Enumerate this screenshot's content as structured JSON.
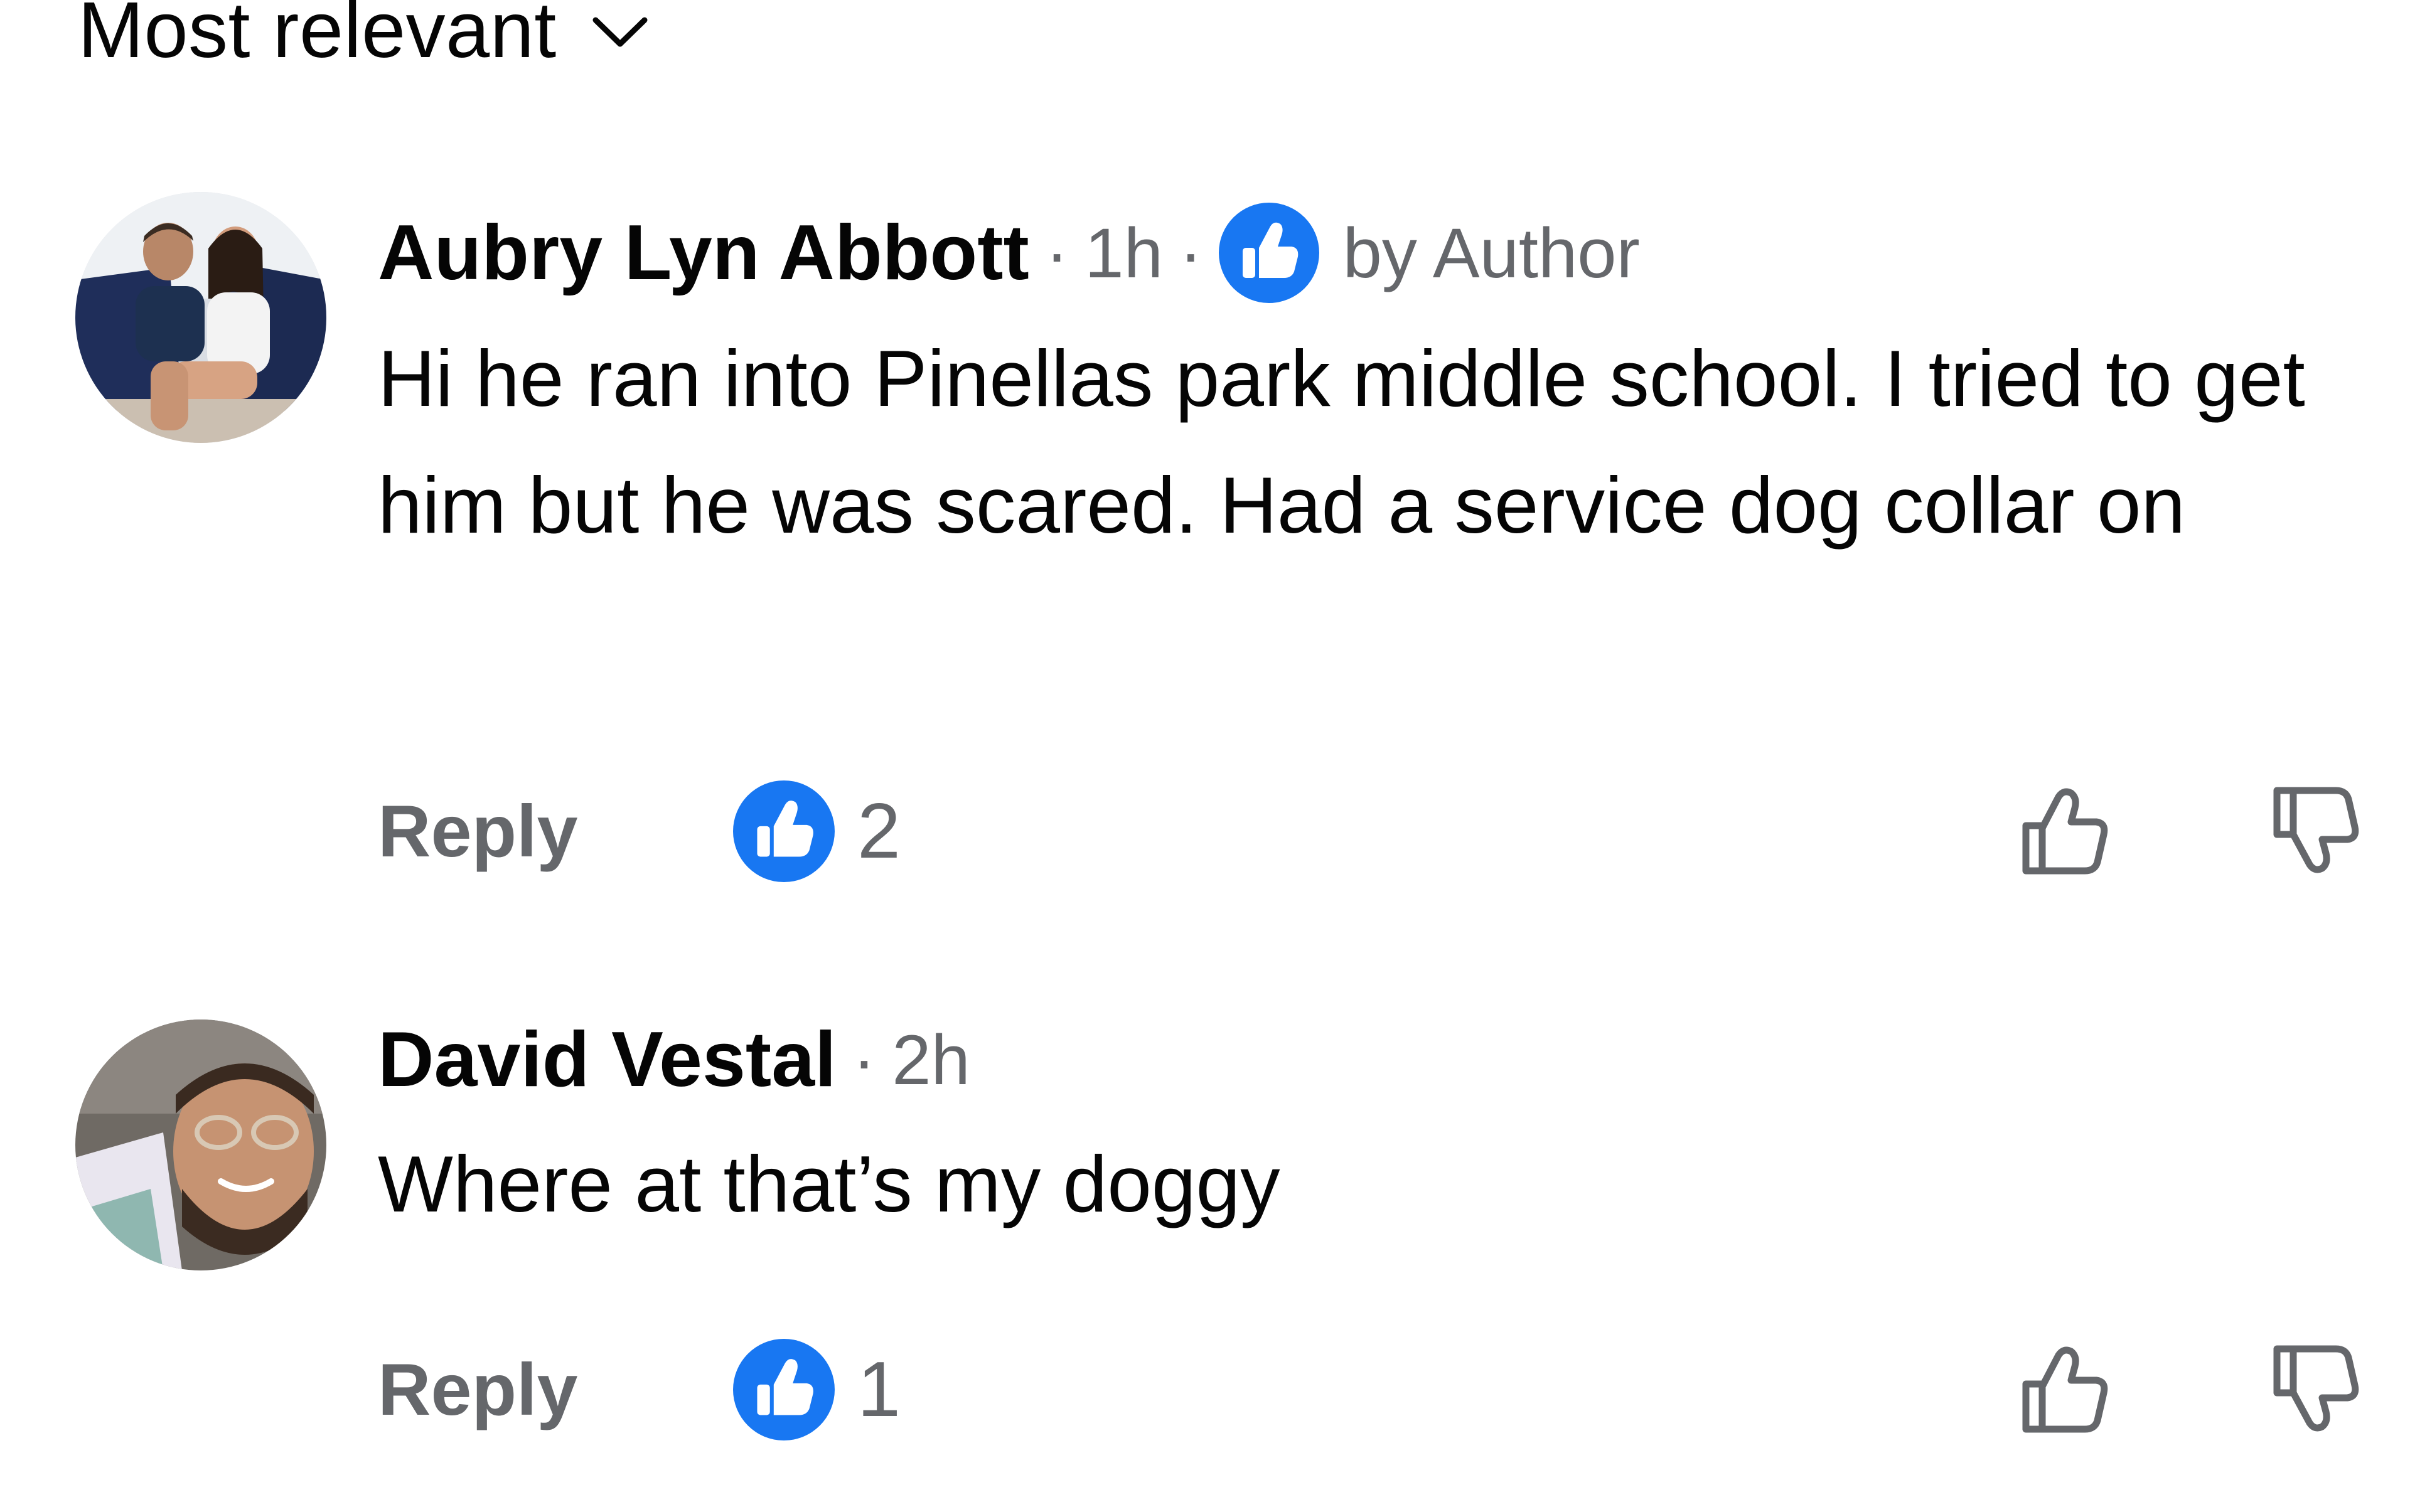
{
  "sort": {
    "label": "Most relevant",
    "icon": "chevron-down-icon"
  },
  "comments": [
    {
      "author": "Aubry Lyn Abbott",
      "separator": "·",
      "time": "1h",
      "author_liked": true,
      "author_badge_icon": "thumbs-up-badge-icon",
      "author_badge_label": "by Author",
      "text": "Hi he ran into Pinellas park middle school. I tried to get him but he was scared. Had a service dog collar on",
      "reply_label": "Reply",
      "reaction_icon": "thumbs-up-badge-icon",
      "reaction_count": "2",
      "upvote_icon": "thumbs-up-outline-icon",
      "downvote_icon": "thumbs-down-outline-icon"
    },
    {
      "author": "David Vestal",
      "separator": "·",
      "time": "2h",
      "author_liked": false,
      "text": "Where at that’s my doggy",
      "reply_label": "Reply",
      "reaction_icon": "thumbs-up-badge-icon",
      "reaction_count": "1",
      "upvote_icon": "thumbs-up-outline-icon",
      "downvote_icon": "thumbs-down-outline-icon"
    }
  ],
  "colors": {
    "primary_text": "#050505",
    "secondary_text": "#65676b",
    "like_blue": "#1877f2"
  }
}
